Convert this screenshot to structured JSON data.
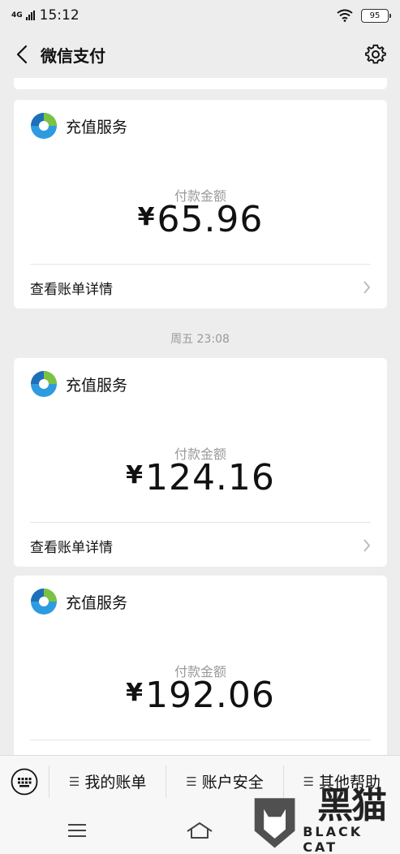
{
  "status_bar": {
    "network": "4G",
    "time": "15:12",
    "battery": "95"
  },
  "header": {
    "title": "微信支付"
  },
  "cards": [
    {
      "merchant": "充值服务",
      "amount_label": "付款金额",
      "currency": "¥",
      "amount": "65.96",
      "detail_link": "查看账单详情"
    },
    {
      "merchant": "充值服务",
      "amount_label": "付款金额",
      "currency": "¥",
      "amount": "124.16",
      "detail_link": "查看账单详情"
    },
    {
      "merchant": "充值服务",
      "amount_label": "付款金额",
      "currency": "¥",
      "amount": "192.06"
    }
  ],
  "date_separator": "周五 23:08",
  "bottom_menu": {
    "items": [
      "我的账单",
      "账户安全",
      "其他帮助"
    ]
  },
  "watermark": {
    "cn": "黑猫",
    "en": "BLACK CAT"
  },
  "colors": {
    "background": "#ededed",
    "card": "#ffffff",
    "secondary_text": "#9a9a9a"
  },
  "icons": [
    "back-arrow-icon",
    "settings-gear-icon",
    "wechat-pay-service-logo",
    "keyboard-icon",
    "menu-icon",
    "home-icon"
  ]
}
